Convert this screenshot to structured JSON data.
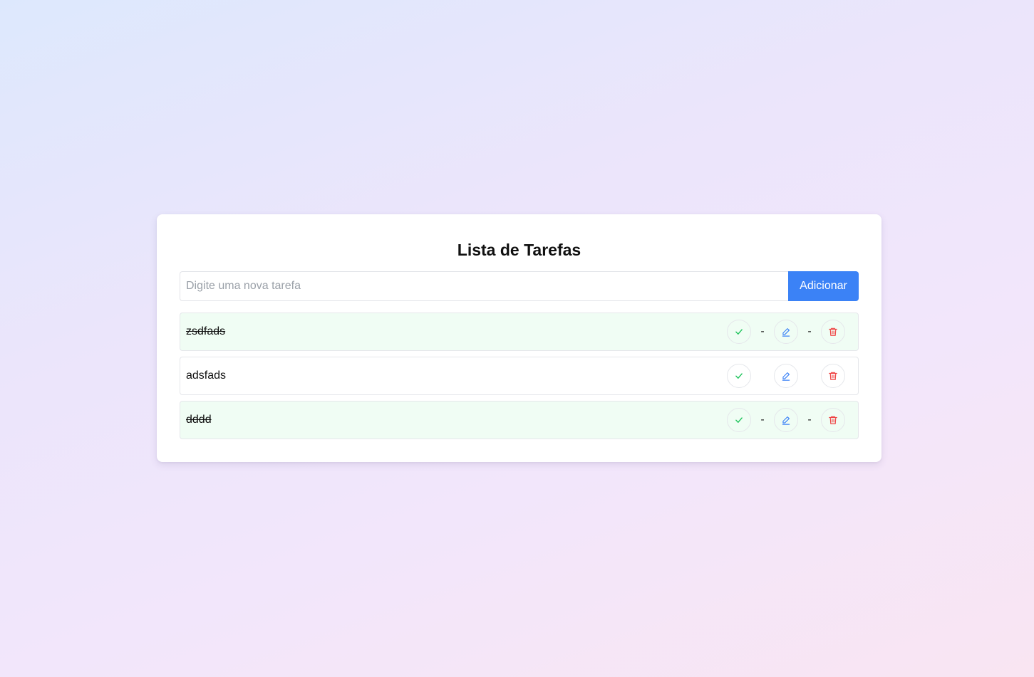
{
  "header": {
    "title": "Lista de Tarefas"
  },
  "add_form": {
    "placeholder": "Digite uma nova tarefa",
    "value": "",
    "button_label": "Adicionar"
  },
  "tasks": [
    {
      "text": "zsdfads",
      "completed": true,
      "separator": "-"
    },
    {
      "text": "adsfads",
      "completed": false,
      "separator": ""
    },
    {
      "text": "dddd",
      "completed": true,
      "separator": "-"
    }
  ],
  "icons": {
    "complete": "check-icon",
    "edit": "pencil-icon",
    "delete": "trash-icon"
  },
  "colors": {
    "accent": "#3b82f6",
    "complete_icon": "#22c55e",
    "edit_icon": "#3b82f6",
    "delete_icon": "#ef4444",
    "completed_row_bg": "#f0fdf4"
  }
}
